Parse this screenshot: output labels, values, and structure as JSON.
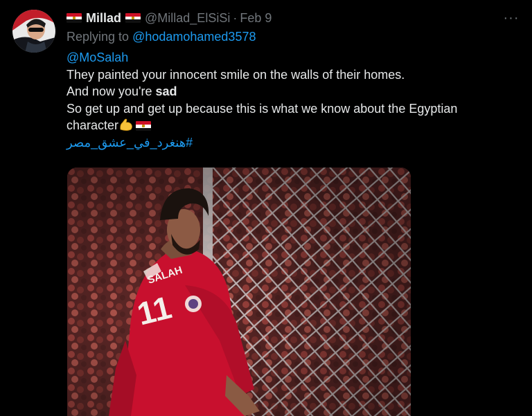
{
  "tweet": {
    "author": {
      "display_name": "Millad",
      "handle": "@Millad_ElSiSi",
      "flag_icon": "egypt-flag-icon"
    },
    "separator": "·",
    "timestamp": "Feb 9",
    "more_label": "···",
    "reply": {
      "prefix": "Replying to",
      "to": "@hodamohamed3578"
    },
    "mention": "@MoSalah",
    "lines": {
      "line1": "They painted your innocent smile on the walls of their homes.",
      "line2_prefix": "And now you're ",
      "line2_bold": "sad",
      "line3": "So get up and get up because this is what we know about the Egyptian",
      "line4": "character"
    },
    "hashtag": "#هنغرد_في_عشق_مصر",
    "media": {
      "jersey_name": "SALAH",
      "jersey_number": "11"
    }
  },
  "colors": {
    "background": "#000000",
    "text": "#e7e9ea",
    "muted": "#71767b",
    "link": "#1d9bf0",
    "jersey": "#c8102e"
  }
}
